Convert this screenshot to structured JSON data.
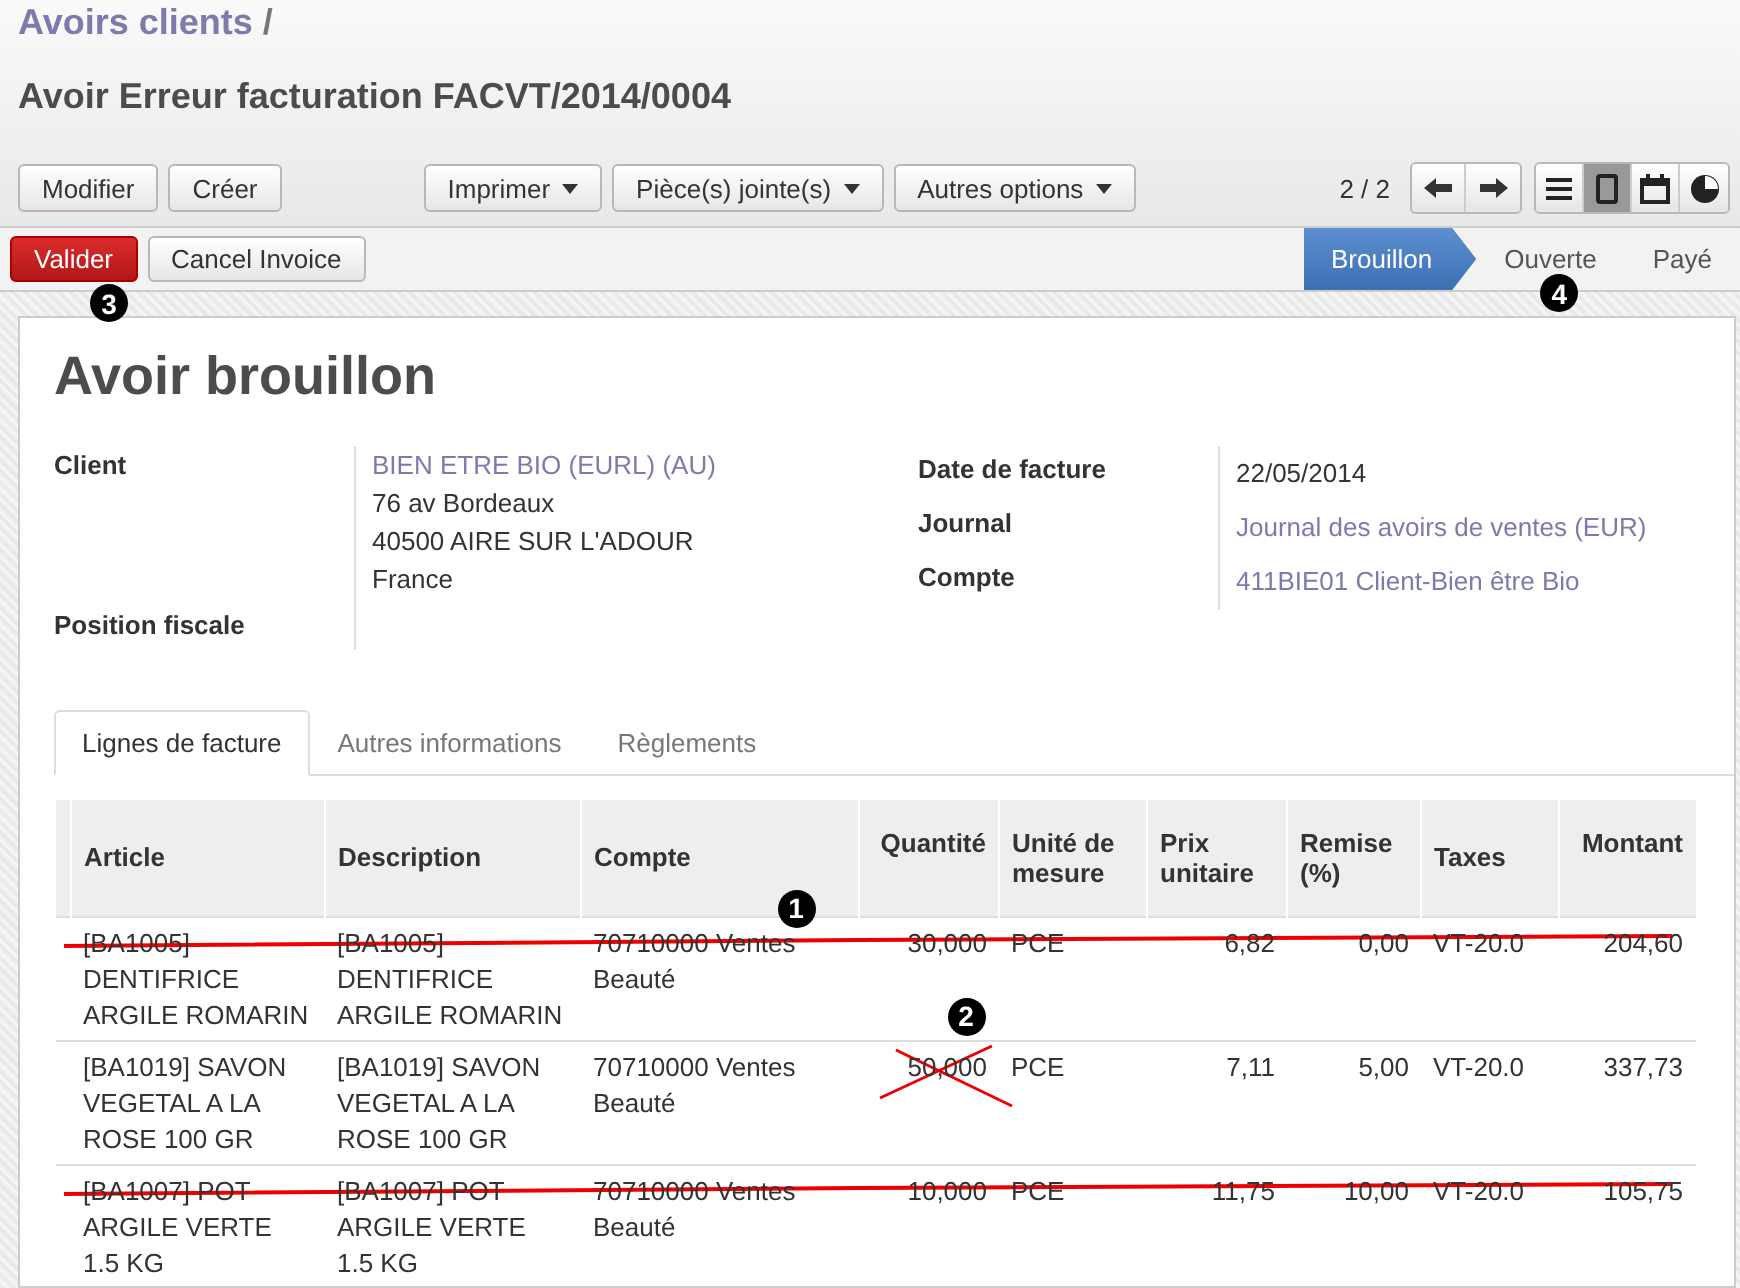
{
  "breadcrumb": {
    "parent": "Avoirs clients",
    "separator": "/"
  },
  "title": "Avoir Erreur facturation FACVT/2014/0004",
  "toolbar": {
    "buttons": [
      {
        "label": "Modifier"
      },
      {
        "label": "Créer"
      }
    ],
    "dropdowns": [
      {
        "label": "Imprimer"
      },
      {
        "label": "Pièce(s) jointe(s)"
      },
      {
        "label": "Autres options"
      }
    ],
    "pager": "2 / 2",
    "views": [
      {
        "kind": "list",
        "selected": false
      },
      {
        "kind": "form",
        "selected": true
      },
      {
        "kind": "calendar",
        "selected": false
      },
      {
        "kind": "graph",
        "selected": false
      }
    ]
  },
  "status_bar": {
    "buttons": [
      {
        "label": "Valider",
        "kind": "primary",
        "callout": "3"
      },
      {
        "label": "Cancel Invoice",
        "kind": "default"
      }
    ],
    "stages": [
      {
        "label": "Brouillon",
        "selected": true
      },
      {
        "label": "Ouverte",
        "selected": false,
        "callout": "4"
      },
      {
        "label": "Payé",
        "selected": false
      }
    ]
  },
  "sheet": {
    "heading": "Avoir brouillon",
    "left_fields": [
      {
        "label": "Client",
        "lines": [
          {
            "text": "BIEN ETRE BIO (EURL) (AU)",
            "link": true
          },
          {
            "text": "76 av Bordeaux",
            "link": false
          },
          {
            "text": "40500 AIRE SUR L'ADOUR",
            "link": false
          },
          {
            "text": "France",
            "link": false
          }
        ]
      },
      {
        "label": "Position fiscale"
      }
    ],
    "right_fields": [
      {
        "label": "Date de facture",
        "value": "22/05/2014",
        "link": false
      },
      {
        "label": "Journal",
        "value": "Journal des avoirs de ventes (EUR)",
        "link": true
      },
      {
        "label": "Compte",
        "value": "411BIE01 Client-Bien être Bio",
        "link": true
      }
    ],
    "tabs": [
      {
        "label": "Lignes de facture",
        "selected": true
      },
      {
        "label": "Autres informations",
        "selected": false
      },
      {
        "label": "Règlements",
        "selected": false
      }
    ],
    "table": {
      "columns": [
        {
          "label": "Article"
        },
        {
          "label": "Description"
        },
        {
          "label": "Compte"
        },
        {
          "label": "Quantité"
        },
        {
          "label": "Unité de mesure"
        },
        {
          "label": "Prix unitaire"
        },
        {
          "label": "Remise (%)"
        },
        {
          "label": "Taxes"
        },
        {
          "label": "Montant"
        }
      ],
      "rows": [
        {
          "cells": [
            "[BA1005] DENTIFRICE ARGILE ROMARIN",
            "[BA1005] DENTIFRICE ARGILE ROMARIN",
            "70710000 Ventes Beauté",
            "30,000",
            "PCE",
            "6,82",
            "0,00",
            "VT-20.0",
            "204,60"
          ],
          "struck": true,
          "crossed_quantity": false,
          "callout": "1"
        },
        {
          "cells": [
            "[BA1019] SAVON VEGETAL A LA ROSE 100 GR",
            "[BA1019] SAVON VEGETAL A LA ROSE 100 GR",
            "70710000 Ventes Beauté",
            "50,000",
            "PCE",
            "7,11",
            "5,00",
            "VT-20.0",
            "337,73"
          ],
          "struck": false,
          "crossed_quantity": true,
          "callout": "2"
        },
        {
          "cells": [
            "[BA1007] POT ARGILE VERTE 1.5 KG",
            "[BA1007] POT ARGILE VERTE 1.5 KG",
            "70710000 Ventes Beauté",
            "10,000",
            "PCE",
            "11,75",
            "10,00",
            "VT-20.0",
            "105,75"
          ],
          "struck": true,
          "crossed_quantity": false
        }
      ]
    }
  }
}
